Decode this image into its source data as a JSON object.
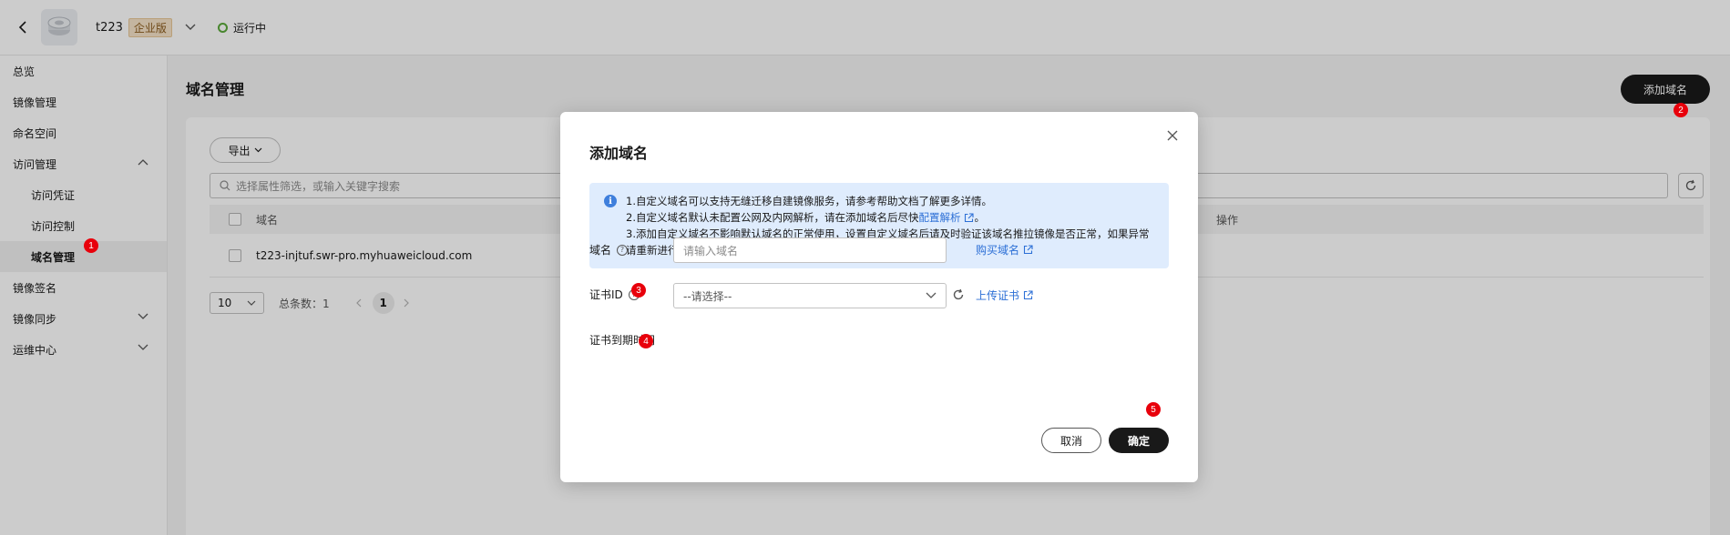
{
  "topbar": {
    "instance_name": "t223",
    "edition_badge": "企业版",
    "status": "运行中"
  },
  "sidebar": {
    "items": [
      {
        "label": "总览"
      },
      {
        "label": "镜像管理"
      },
      {
        "label": "命名空间"
      },
      {
        "label": "访问管理"
      },
      {
        "label": "访问凭证"
      },
      {
        "label": "访问控制"
      },
      {
        "label": "域名管理"
      },
      {
        "label": "镜像签名"
      },
      {
        "label": "镜像同步"
      },
      {
        "label": "运维中心"
      }
    ]
  },
  "main": {
    "title": "域名管理",
    "add_button": "添加域名",
    "export_button": "导出",
    "search_placeholder": "选择属性筛选，或输入关键字搜索",
    "table": {
      "col_name": "域名",
      "col_op": "操作",
      "rows": [
        {
          "name": "t223-injtuf.swr-pro.myhuaweicloud.com"
        }
      ]
    },
    "pager": {
      "size": "10",
      "total": "总条数：1",
      "current": "1"
    }
  },
  "dialog": {
    "title": "添加域名",
    "tip": {
      "line1": "1.自定义域名可以支持无缝迁移自建镜像服务，请参考帮助文档了解更多详情。",
      "line2_prefix": "2.自定义域名默认未配置公网及内网解析，请在添加域名后尽快",
      "line2_link": "配置解析",
      "line2_suffix": "。",
      "line3": "3.添加自定义域名不影响默认域名的正常使用，设置自定义域名后请及时验证该域名推拉镜像是否正常，如果异常请重新进行域名绑定。"
    },
    "domain_label": "域名",
    "domain_placeholder": "请输入域名",
    "buy_domain_link": "购买域名",
    "cert_label": "证书ID",
    "cert_placeholder": "--请选择--",
    "upload_cert_link": "上传证书",
    "expiry_label": "证书到期时间",
    "cancel_button": "取消",
    "ok_button": "确定"
  },
  "markers": {
    "m1": "1",
    "m2": "2",
    "m3": "3",
    "m4": "4",
    "m5": "5"
  },
  "colors": {
    "accent_dark": "#191919",
    "link": "#2c6fd6",
    "marker": "#e8000b",
    "tip_bg": "#dfecfd",
    "status_green": "#5aa83a"
  }
}
